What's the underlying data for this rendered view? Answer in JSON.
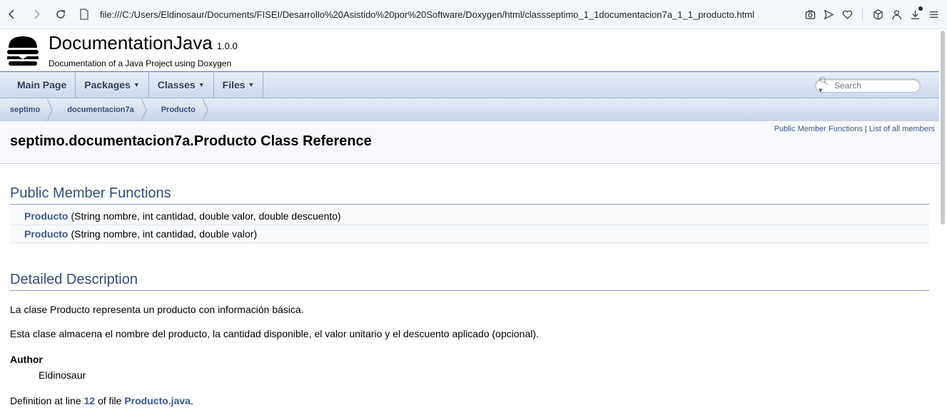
{
  "browser": {
    "url": "file:///C:/Users/Eldinosaur/Documents/FISEI/Desarrollo%20Asistido%20por%20Software/Doxygen/html/classseptimo_1_1documentacion7a_1_1_producto.html"
  },
  "titlearea": {
    "project_name": "DocumentationJava",
    "project_number": "1.0.0",
    "project_brief": "Documentation of a Java Project using Doxygen"
  },
  "tabs": {
    "main_page": "Main Page",
    "packages": "Packages",
    "classes": "Classes",
    "files": "Files",
    "search_placeholder": "Search"
  },
  "navpath": [
    "septimo",
    "documentacion7a",
    "Producto"
  ],
  "header": {
    "summary_public": "Public Member Functions",
    "summary_sep": " | ",
    "summary_all": "List of all members",
    "title": "septimo.documentacion7a.Producto Class Reference"
  },
  "public_member_functions": {
    "heading": "Public Member Functions",
    "rows": [
      {
        "name": "Producto",
        "args": "(String nombre, int cantidad, double valor, double descuento)"
      },
      {
        "name": "Producto",
        "args": "(String nombre, int cantidad, double valor)"
      }
    ]
  },
  "detailed_description": {
    "heading": "Detailed Description",
    "para1": "La clase Producto representa un producto con información básica.",
    "para2": "Esta clase almacena el nombre del producto, la cantidad disponible, el valor unitario y el descuento aplicado (opcional).",
    "author_label": "Author",
    "author_value": "Eldinosaur",
    "def_prefix": "Definition at line ",
    "def_line": "12",
    "def_mid": " of file ",
    "def_file": "Producto.java",
    "def_suffix": "."
  },
  "icons": [
    "back-icon",
    "forward-icon",
    "reload-icon",
    "page-icon",
    "camera-icon",
    "send-icon",
    "heart-icon",
    "cube-icon",
    "user-icon",
    "download-icon",
    "menu-icon",
    "search-icon",
    "doxygen-logo"
  ]
}
